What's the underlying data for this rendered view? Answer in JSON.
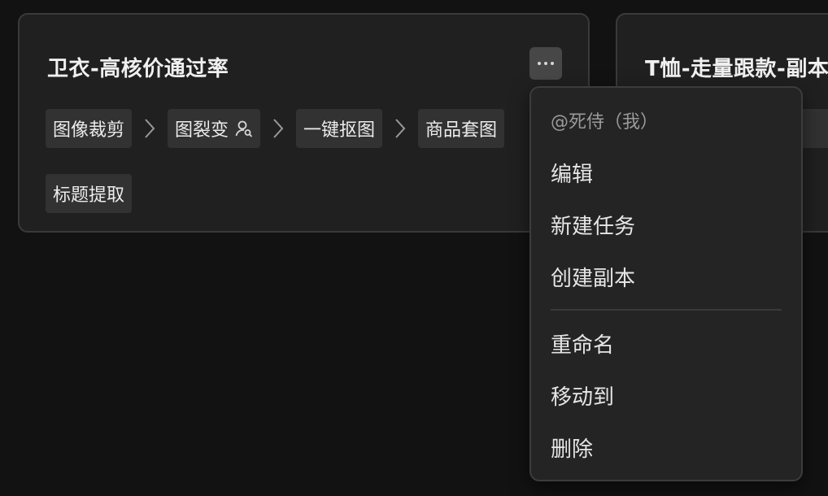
{
  "cards": [
    {
      "title": "卫衣-高核价通过率",
      "steps_row1": [
        "图像裁剪",
        "图裂变",
        "一键抠图",
        "商品套图"
      ],
      "steps_row2": [
        "标题提取"
      ]
    },
    {
      "title": "T恤-走量跟款-副本"
    }
  ],
  "menu": {
    "header": "@死侍（我）",
    "items": [
      "编辑",
      "新建任务",
      "创建副本",
      "重命名",
      "移动到",
      "删除"
    ]
  },
  "colors": {
    "background": "#121212",
    "card": "#202020",
    "chip": "#323232",
    "menu": "#242424",
    "text": "#ececec",
    "muted_text": "#9a9a9a"
  },
  "icons": [
    "more-horizontal-icon",
    "user-search-icon",
    "chevron-right-icon"
  ]
}
